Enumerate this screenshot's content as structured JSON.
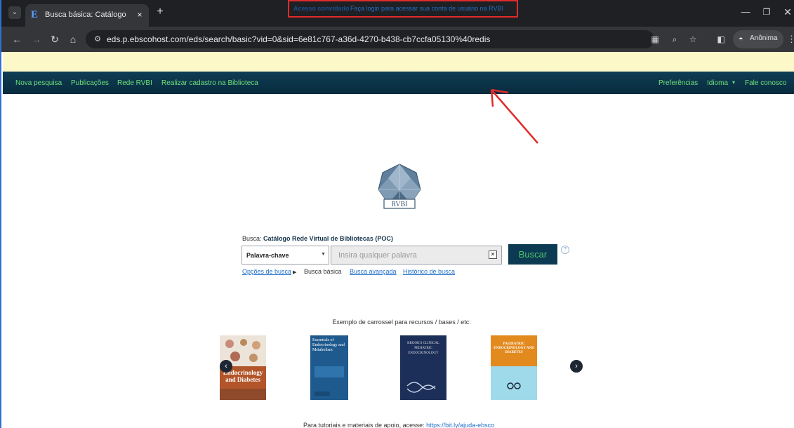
{
  "browser": {
    "tab_title": "Busca básica: Catálogo Rede Vi",
    "tab_close": "×",
    "new_tab": "+",
    "url": "eds.p.ebscohost.com/eds/search/basic?vid=0&sid=6e81c767-a36d-4270-b438-cb7ccfa05130%40redis",
    "incognito_label": "Anônima"
  },
  "banner": {
    "strong": "Acesso convidado",
    "link": "Faça login para acessar sua conta de usuário na RVBI",
    "highlight_color": "#e12b2b"
  },
  "nav": {
    "left": [
      "Nova pesquisa",
      "Publicações",
      "Rede RVBI",
      "Realizar cadastro na Biblioteca"
    ],
    "right": [
      "Preferências",
      "Idioma",
      "Fale conosco"
    ],
    "link_color": "#6fe07a"
  },
  "logo": {
    "text": "RVBI"
  },
  "search": {
    "scope_prefix": "Busca:",
    "scope_name": "Catálogo Rede Virtual de Bibliotecas (POC)",
    "field_select": "Palavra-chave",
    "placeholder": "Insira qualquer palavra",
    "button": "Buscar",
    "links": {
      "options": "Opções de busca",
      "basic": "Busca básica",
      "advanced": "Busca avançada",
      "history": "Histórico de busca"
    }
  },
  "carousel": {
    "title": "Exemplo de carrossel para recursos / bases / etc:",
    "books": [
      {
        "title": "Endocrinology and Diabetes"
      },
      {
        "title": "Essentials of Endocrinology and Metabolism"
      },
      {
        "title": "BROOK'S CLINICAL PEDIATRIC ENDOCRINOLOGY"
      },
      {
        "title": "PAEDIATRIC ENDOCRINOLOGY AND DIABETES"
      }
    ]
  },
  "footer": {
    "text": "Para tutoriais e materiais de apoio, acesse:",
    "link": "https://bit.ly/ajuda-ebsco"
  }
}
